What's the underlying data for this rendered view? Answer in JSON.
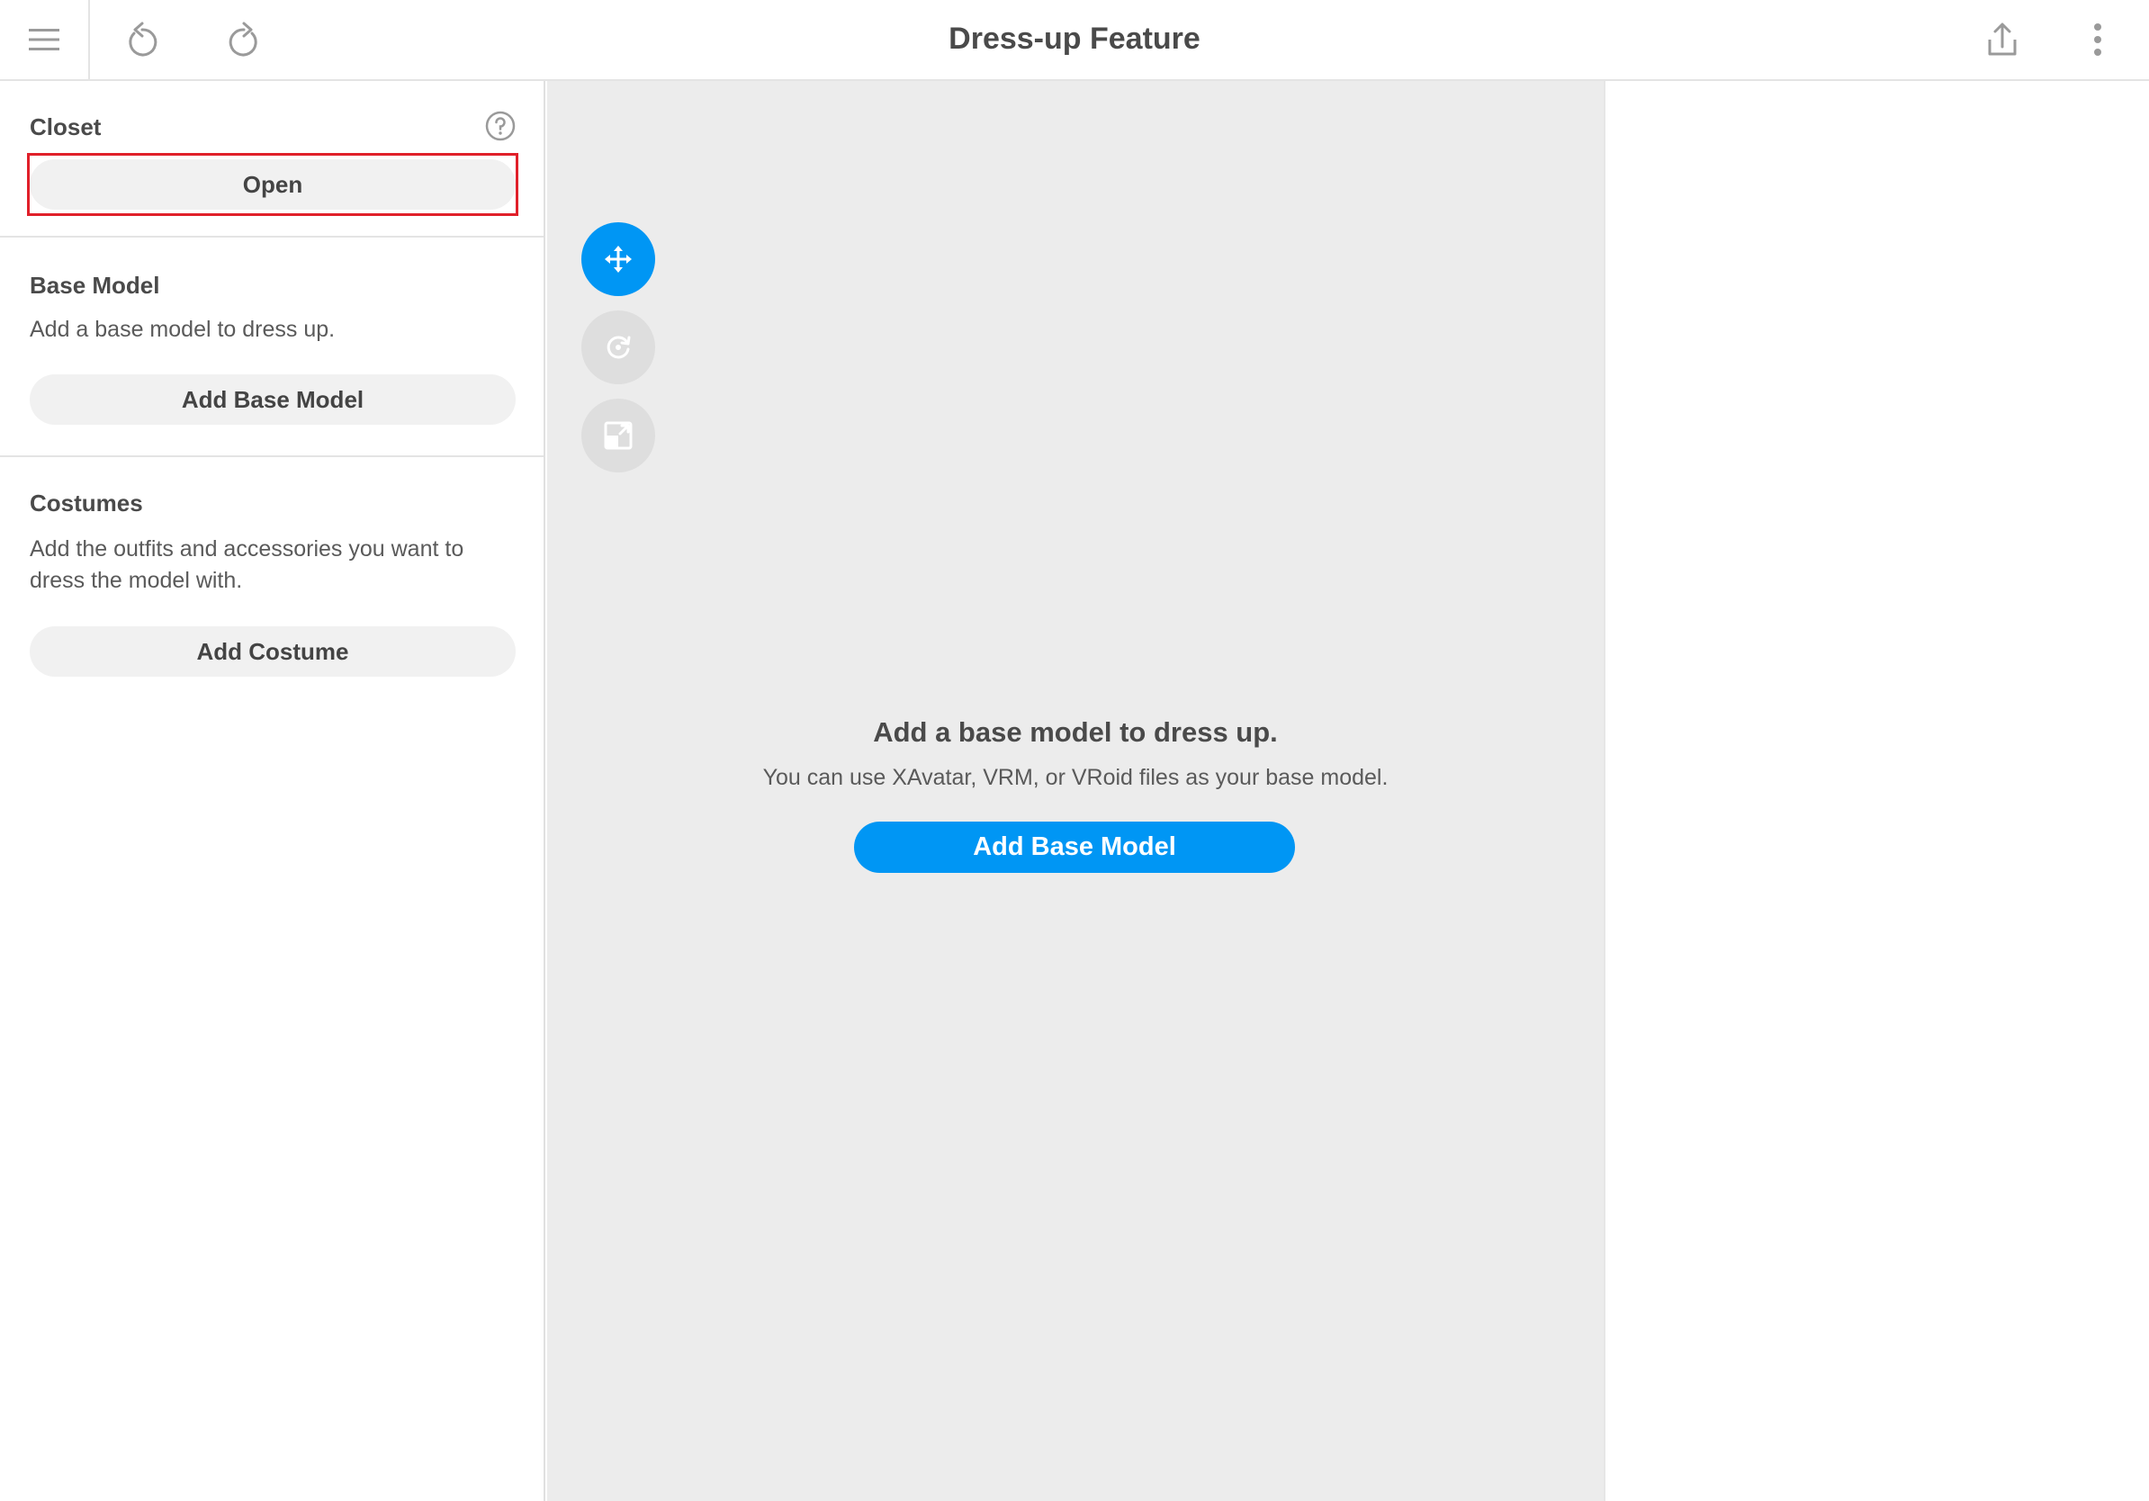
{
  "header": {
    "title": "Dress-up Feature",
    "icons": [
      "hamburger-icon",
      "undo-icon",
      "redo-icon",
      "share-icon",
      "more-vertical-icon"
    ]
  },
  "sidebar": {
    "closet": {
      "title": "Closet",
      "open_label": "Open",
      "help_icon": "help-circle-icon"
    },
    "base_model": {
      "title": "Base Model",
      "description": "Add a base model to dress up.",
      "button_label": "Add Base Model"
    },
    "costumes": {
      "title": "Costumes",
      "description": "Add the outfits and accessories you want to dress the model with.",
      "button_label": "Add Costume"
    }
  },
  "viewport": {
    "tools": [
      "move-icon",
      "rotate-icon",
      "scale-icon"
    ],
    "empty_state": {
      "title": "Add a base model to dress up.",
      "subtitle": "You can use XAvatar, VRM, or VRoid files as your base model.",
      "button_label": "Add Base Model"
    }
  },
  "colors": {
    "accent": "#0096f4",
    "highlight_frame": "#e0202a",
    "viewport_bg": "#ececec"
  }
}
